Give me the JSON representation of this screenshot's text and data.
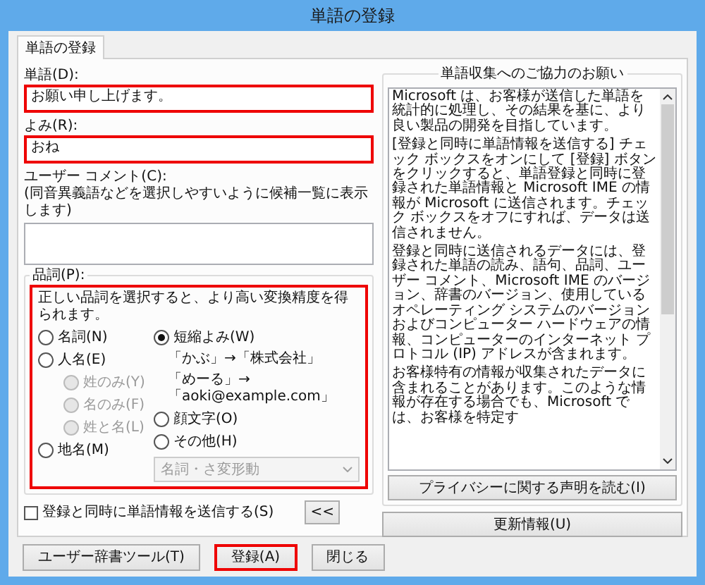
{
  "window": {
    "title": "単語の登録"
  },
  "tabs": [
    {
      "label": "単語の登録",
      "selected": true
    }
  ],
  "word": {
    "label": "単語(D):",
    "value": "お願い申し上げます。",
    "highlighted": true
  },
  "reading": {
    "label": "よみ(R):",
    "value": "おね",
    "highlighted": true
  },
  "comment": {
    "label": "ユーザー コメント(C):",
    "hint": "(同音異義語などを選択しやすいように候補一覧に表示します)"
  },
  "part_of_speech": {
    "label": "品詞(P):",
    "hint": "正しい品詞を選択すると、より高い変換精度を得られます。",
    "highlighted": true,
    "left_options": [
      {
        "label": "名詞(N)",
        "selected": false,
        "disabled": false
      },
      {
        "label": "人名(E)",
        "selected": false,
        "disabled": false,
        "children": [
          {
            "label": "姓のみ(Y)",
            "selected": false,
            "disabled": true
          },
          {
            "label": "名のみ(F)",
            "selected": false,
            "disabled": true
          },
          {
            "label": "姓と名(L)",
            "selected": false,
            "disabled": true
          }
        ]
      },
      {
        "label": "地名(M)",
        "selected": false,
        "disabled": false
      }
    ],
    "right_items": [
      {
        "kind": "radio",
        "label": "短縮よみ(W)",
        "selected": true,
        "disabled": false
      },
      {
        "kind": "example",
        "text": "「かぶ」→「株式会社」"
      },
      {
        "kind": "example",
        "text": "「めーる」→「aoki@example.com」"
      },
      {
        "kind": "radio",
        "label": "顔文字(O)",
        "selected": false,
        "disabled": false
      },
      {
        "kind": "radio",
        "label": "その他(H)",
        "selected": false,
        "disabled": false
      },
      {
        "kind": "dropdown",
        "value": "名詞・さ変形動",
        "disabled": true
      }
    ]
  },
  "send_checkbox": {
    "label": "登録と同時に単語情報を送信する(S)",
    "checked": false
  },
  "collapse_button": "<<",
  "info_group": {
    "title": "単語収集へのご協力のお願い",
    "paragraphs": [
      "Microsoft は、お客様が送信した単語を統計的に処理し、その結果を基に、より良い製品の開発を目指しています。",
      "[登録と同時に単語情報を送信する] チェック ボックスをオンにして [登録] ボタンをクリックすると、単語登録と同時に登録された単語情報と Microsoft IME の情報が Microsoft に送信されます。チェック ボックスをオフにすれば、データは送信されません。",
      "登録と同時に送信されるデータには、登録された単語の読み、語句、品詞、ユーザー コメント、Microsoft IME のバージョン、辞書のバージョン、使用しているオペレーティング システムのバージョンおよびコンピューター ハードウェアの情報、コンピューターのインターネット プロトコル (IP) アドレスが含まれます。",
      "お客様特有の情報が収集されたデータに含まれることがあります。このような情報が存在する場合でも、Microsoft では、お客様を特定す"
    ],
    "privacy_button": "プライバシーに関する声明を読む(I)"
  },
  "update_button": "更新情報(U)",
  "footer_buttons": [
    {
      "label": "ユーザー辞書ツール(T)",
      "highlighted": false
    },
    {
      "label": "登録(A)",
      "highlighted": true
    },
    {
      "label": "閉じる",
      "highlighted": false
    }
  ]
}
